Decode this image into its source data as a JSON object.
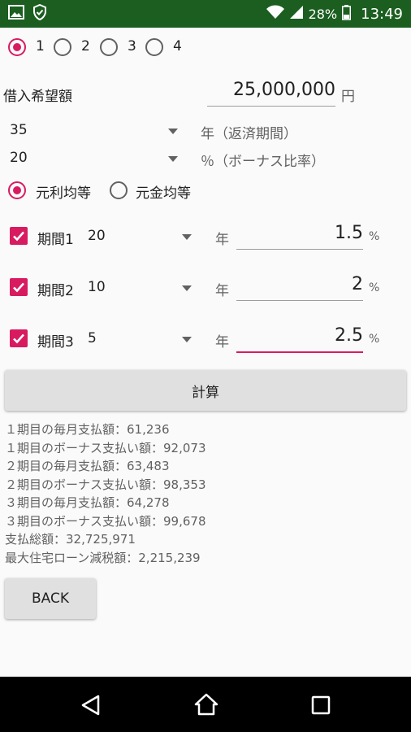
{
  "status_bar": {
    "battery": "28%",
    "time": "13:49",
    "icons": [
      "image-icon",
      "shield-icon",
      "wifi-icon",
      "signal-icon",
      "battery-icon"
    ]
  },
  "pattern_radios": [
    {
      "label": "1",
      "selected": true
    },
    {
      "label": "2",
      "selected": false
    },
    {
      "label": "3",
      "selected": false
    },
    {
      "label": "4",
      "selected": false
    }
  ],
  "loan": {
    "label": "借入希望額",
    "value": "25,000,000",
    "unit": "円"
  },
  "term": {
    "value": "35",
    "label": "年（返済期間）"
  },
  "bonus": {
    "value": "20",
    "label": "％（ボーナス比率）"
  },
  "repayment_method": [
    {
      "label": "元利均等",
      "selected": true
    },
    {
      "label": "元金均等",
      "selected": false
    }
  ],
  "periods": [
    {
      "label": "期間1",
      "years": "20",
      "year_unit": "年",
      "rate": "1.5",
      "rate_unit": "%",
      "checked": true
    },
    {
      "label": "期間2",
      "years": "10",
      "year_unit": "年",
      "rate": "2",
      "rate_unit": "%",
      "checked": true
    },
    {
      "label": "期間3",
      "years": "5",
      "year_unit": "年",
      "rate": "2.5",
      "rate_unit": "%",
      "checked": true
    }
  ],
  "calculate_label": "計算",
  "results": [
    "１期目の毎月支払額：61,236",
    "１期目のボーナス支払い額：92,073",
    "２期目の毎月支払額：63,483",
    "２期目のボーナス支払い額：98,353",
    "３期目の毎月支払額：64,278",
    "３期目のボーナス支払い額：99,678",
    "支払総額：32,725,971",
    "最大住宅ローン減税額：2,215,239"
  ],
  "back_label": "BACK",
  "colors": {
    "accent": "#d81b60",
    "status_bar": "#1b5e20",
    "nav_bar": "#000000"
  }
}
